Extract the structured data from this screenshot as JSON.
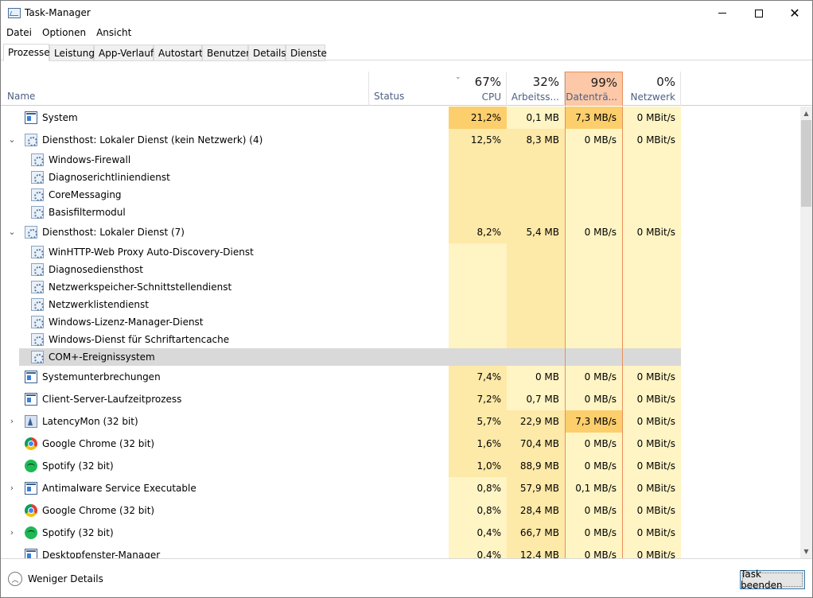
{
  "window": {
    "title": "Task-Manager"
  },
  "menu": [
    "Datei",
    "Optionen",
    "Ansicht"
  ],
  "tabs": [
    "Prozesse",
    "Leistung",
    "App-Verlauf",
    "Autostart",
    "Benutzer",
    "Details",
    "Dienste"
  ],
  "active_tab": "Prozesse",
  "columns": {
    "name": "Name",
    "status": "Status",
    "cpu": {
      "pct": "67%",
      "label": "CPU"
    },
    "memory": {
      "pct": "32%",
      "label": "Arbeitss..."
    },
    "disk": {
      "pct": "99%",
      "label": "Datenträ..."
    },
    "network": {
      "pct": "0%",
      "label": "Netzwerk"
    }
  },
  "colors": {
    "cpu_high": "#fcce6c",
    "cell_mid": "#fde9a8",
    "cell_low": "#fff4c4",
    "disk_header": "#fcc8a8",
    "disk_border": "#e88e5a",
    "selected_row": "#d9d9d9"
  },
  "rows": [
    {
      "name": "System",
      "cpu": "21,2%",
      "mem": "0,1 MB",
      "disk": "7,3 MB/s",
      "net": "0 MBit/s",
      "icon": "system-icon",
      "level": 0,
      "expander": false
    },
    {
      "name": "Diensthost: Lokaler Dienst (kein Netzwerk) (4)",
      "cpu": "12,5%",
      "mem": "8,3 MB",
      "disk": "0 MB/s",
      "net": "0 MBit/s",
      "icon": "gear-icon",
      "level": 0,
      "expander": true,
      "expanded": true
    },
    {
      "name": "Windows-Firewall",
      "icon": "gear-icon",
      "level": 1
    },
    {
      "name": "Diagnoserichtliniendienst",
      "icon": "gear-icon",
      "level": 1
    },
    {
      "name": "CoreMessaging",
      "icon": "gear-icon",
      "level": 1
    },
    {
      "name": "Basisfiltermodul",
      "icon": "gear-icon",
      "level": 1
    },
    {
      "name": "Diensthost: Lokaler Dienst (7)",
      "cpu": "8,2%",
      "mem": "5,4 MB",
      "disk": "0 MB/s",
      "net": "0 MBit/s",
      "icon": "gear-icon",
      "level": 0,
      "expander": true,
      "expanded": true
    },
    {
      "name": "WinHTTP-Web Proxy Auto-Discovery-Dienst",
      "icon": "gear-icon",
      "level": 1
    },
    {
      "name": "Diagnosediensthost",
      "icon": "gear-icon",
      "level": 1
    },
    {
      "name": "Netzwerkspeicher-Schnittstellendienst",
      "icon": "gear-icon",
      "level": 1
    },
    {
      "name": "Netzwerklistendienst",
      "icon": "gear-icon",
      "level": 1
    },
    {
      "name": "Windows-Lizenz-Manager-Dienst",
      "icon": "gear-icon",
      "level": 1
    },
    {
      "name": "Windows-Dienst für Schriftartencache",
      "icon": "gear-icon",
      "level": 1
    },
    {
      "name": "COM+-Ereignissystem",
      "icon": "gear-icon",
      "level": 1,
      "selected": true
    },
    {
      "name": "Systemunterbrechungen",
      "cpu": "7,4%",
      "mem": "0 MB",
      "disk": "0 MB/s",
      "net": "0 MBit/s",
      "icon": "system-icon",
      "level": 0,
      "expander": false
    },
    {
      "name": "Client-Server-Laufzeitprozess",
      "cpu": "7,2%",
      "mem": "0,7 MB",
      "disk": "0 MB/s",
      "net": "0 MBit/s",
      "icon": "system-icon",
      "level": 0,
      "expander": false
    },
    {
      "name": "LatencyMon (32 bit)",
      "cpu": "5,7%",
      "mem": "22,9 MB",
      "disk": "7,3 MB/s",
      "net": "0 MBit/s",
      "icon": "latencymon-icon",
      "level": 0,
      "expander": true,
      "expanded": false
    },
    {
      "name": "Google Chrome (32 bit)",
      "cpu": "1,6%",
      "mem": "70,4 MB",
      "disk": "0 MB/s",
      "net": "0 MBit/s",
      "icon": "chrome-icon",
      "level": 0,
      "expander": false
    },
    {
      "name": "Spotify (32 bit)",
      "cpu": "1,0%",
      "mem": "88,9 MB",
      "disk": "0 MB/s",
      "net": "0 MBit/s",
      "icon": "spotify-icon",
      "level": 0,
      "expander": false
    },
    {
      "name": "Antimalware Service Executable",
      "cpu": "0,8%",
      "mem": "57,9 MB",
      "disk": "0,1 MB/s",
      "net": "0 MBit/s",
      "icon": "system-icon",
      "level": 0,
      "expander": true,
      "expanded": false
    },
    {
      "name": "Google Chrome (32 bit)",
      "cpu": "0,8%",
      "mem": "28,4 MB",
      "disk": "0 MB/s",
      "net": "0 MBit/s",
      "icon": "chrome-icon",
      "level": 0,
      "expander": false
    },
    {
      "name": "Spotify (32 bit)",
      "cpu": "0,4%",
      "mem": "66,7 MB",
      "disk": "0 MB/s",
      "net": "0 MBit/s",
      "icon": "spotify-icon",
      "level": 0,
      "expander": true,
      "expanded": false
    },
    {
      "name": "Desktopfenster-Manager",
      "cpu": "0,4%",
      "mem": "12,4 MB",
      "disk": "0 MB/s",
      "net": "0 MBit/s",
      "icon": "system-icon",
      "level": 0,
      "expander": false
    }
  ],
  "footer": {
    "fewer_details": "Weniger Details",
    "end_task": "Task beenden"
  }
}
